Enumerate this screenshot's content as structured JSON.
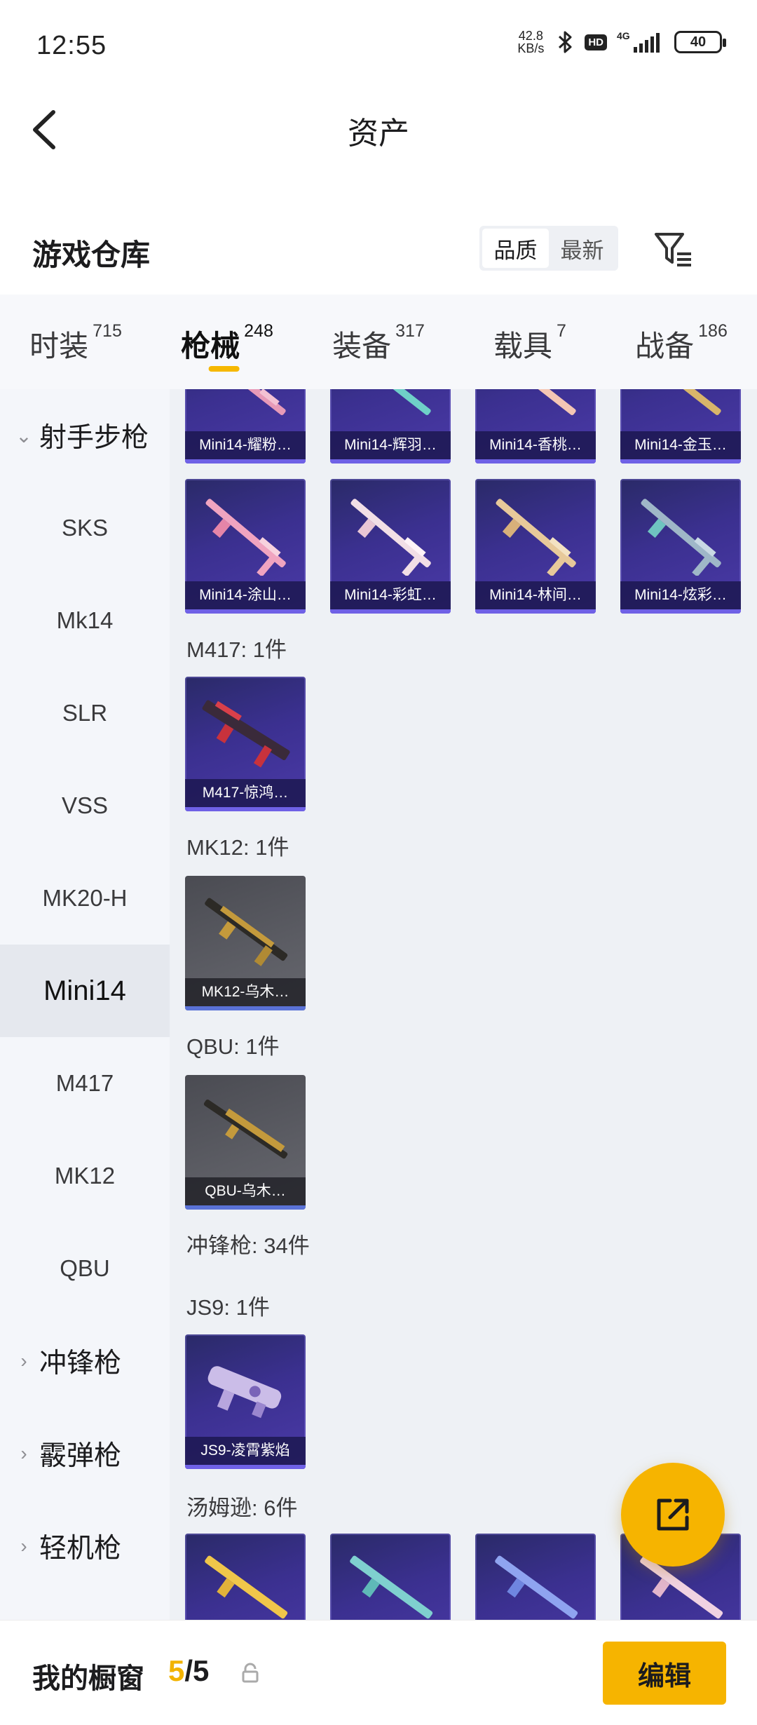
{
  "status": {
    "time": "12:55",
    "net_speed_value": "42.8",
    "net_speed_unit": "KB/s",
    "hd": "HD",
    "net_type": "4G",
    "battery": "40"
  },
  "header": {
    "title": "资产"
  },
  "warehouse": {
    "title": "游戏仓库",
    "sort_options": [
      "品质",
      "最新"
    ],
    "active_sort": "品质"
  },
  "tabs": [
    {
      "label": "时装",
      "count": "715"
    },
    {
      "label": "枪械",
      "count": "248",
      "active": true
    },
    {
      "label": "装备",
      "count": "317"
    },
    {
      "label": "载具",
      "count": "7"
    },
    {
      "label": "战备",
      "count": "186"
    }
  ],
  "sidebar": {
    "items": [
      {
        "label": "射手步枪",
        "type": "group",
        "expanded": true
      },
      {
        "label": "SKS"
      },
      {
        "label": "Mk14"
      },
      {
        "label": "SLR"
      },
      {
        "label": "VSS"
      },
      {
        "label": "MK20-H"
      },
      {
        "label": "Mini14",
        "active": true
      },
      {
        "label": "M417"
      },
      {
        "label": "MK12"
      },
      {
        "label": "QBU"
      },
      {
        "label": "冲锋枪",
        "type": "group",
        "expanded": false
      },
      {
        "label": "霰弹枪",
        "type": "group",
        "expanded": false
      },
      {
        "label": "轻机枪",
        "type": "group",
        "expanded": false
      }
    ]
  },
  "content": {
    "mini14_row1": [
      "Mini14-耀粉…",
      "Mini14-辉羽…",
      "Mini14-香桃…",
      "Mini14-金玉…"
    ],
    "mini14_row2": [
      "Mini14-涂山…",
      "Mini14-彩虹…",
      "Mini14-林间…",
      "Mini14-炫彩…"
    ],
    "m417_title": "M417: 1件",
    "m417_items": [
      "M417-惊鸿…"
    ],
    "mk12_title": "MK12: 1件",
    "mk12_items": [
      "MK12-乌木…"
    ],
    "qbu_title": "QBU: 1件",
    "qbu_items": [
      "QBU-乌木…"
    ],
    "smg_title": "冲锋枪: 34件",
    "js9_title": "JS9: 1件",
    "js9_items": [
      "JS9-凌霄紫焰"
    ],
    "thompson_title": "汤姆逊: 6件"
  },
  "bottom": {
    "title": "我的橱窗",
    "current": "5",
    "separator": "/",
    "total": "5",
    "edit_label": "编辑"
  },
  "colors": {
    "accent": "#f6b400",
    "tile_purple": "#3b3090",
    "tile_gray": "#5c5d64",
    "sidebar_bg": "#f4f6fa",
    "content_bg": "#eef1f5"
  }
}
